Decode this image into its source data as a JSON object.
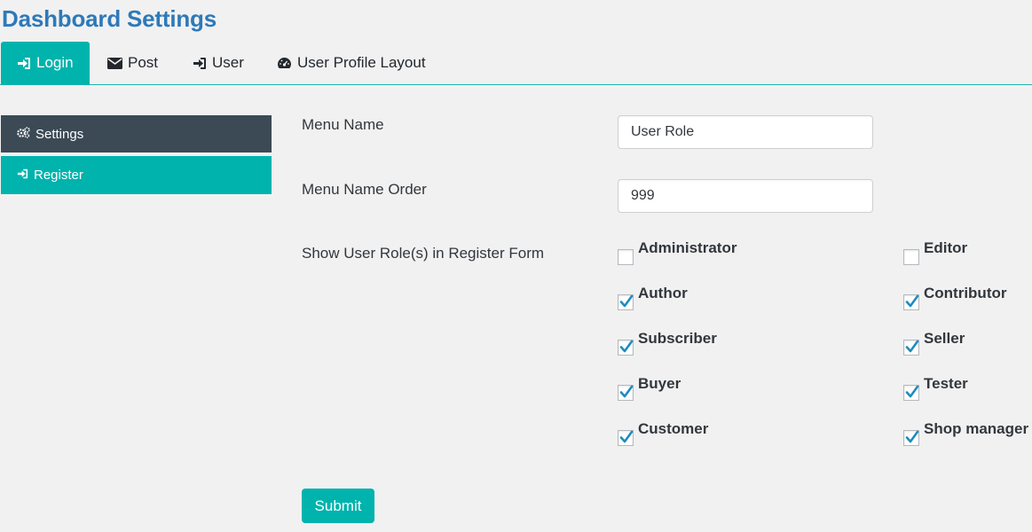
{
  "page": {
    "title": "Dashboard Settings"
  },
  "tabs": [
    {
      "label": "Login",
      "icon": "sign-in-icon",
      "active": true
    },
    {
      "label": "Post",
      "icon": "envelope-icon",
      "active": false
    },
    {
      "label": "User",
      "icon": "sign-in-icon",
      "active": false
    },
    {
      "label": "User Profile Layout",
      "icon": "dashboard-icon",
      "active": false
    }
  ],
  "sidebar": {
    "items": [
      {
        "label": "Settings",
        "icon": "gears-icon",
        "color": "#3b4a55"
      },
      {
        "label": "Register",
        "icon": "sign-in-icon",
        "color": "#00b3ad"
      }
    ]
  },
  "form": {
    "menu_name": {
      "label": "Menu Name",
      "value": "User Role"
    },
    "menu_order": {
      "label": "Menu Name Order",
      "value": "999"
    },
    "roles_label": "Show User Role(s) in Register Form",
    "roles": [
      {
        "label": "Administrator",
        "checked": false
      },
      {
        "label": "Editor",
        "checked": false
      },
      {
        "label": "Author",
        "checked": true
      },
      {
        "label": "Contributor",
        "checked": true
      },
      {
        "label": "Subscriber",
        "checked": true
      },
      {
        "label": "Seller",
        "checked": true
      },
      {
        "label": "Buyer",
        "checked": true
      },
      {
        "label": "Tester",
        "checked": true
      },
      {
        "label": "Customer",
        "checked": true
      },
      {
        "label": "Shop manager",
        "checked": true
      }
    ],
    "submit_label": "Submit"
  },
  "colors": {
    "accent": "#00b3ad",
    "title": "#2e79b9",
    "sidebar_dark": "#3b4a55",
    "checkmark": "#1e8cbe"
  }
}
